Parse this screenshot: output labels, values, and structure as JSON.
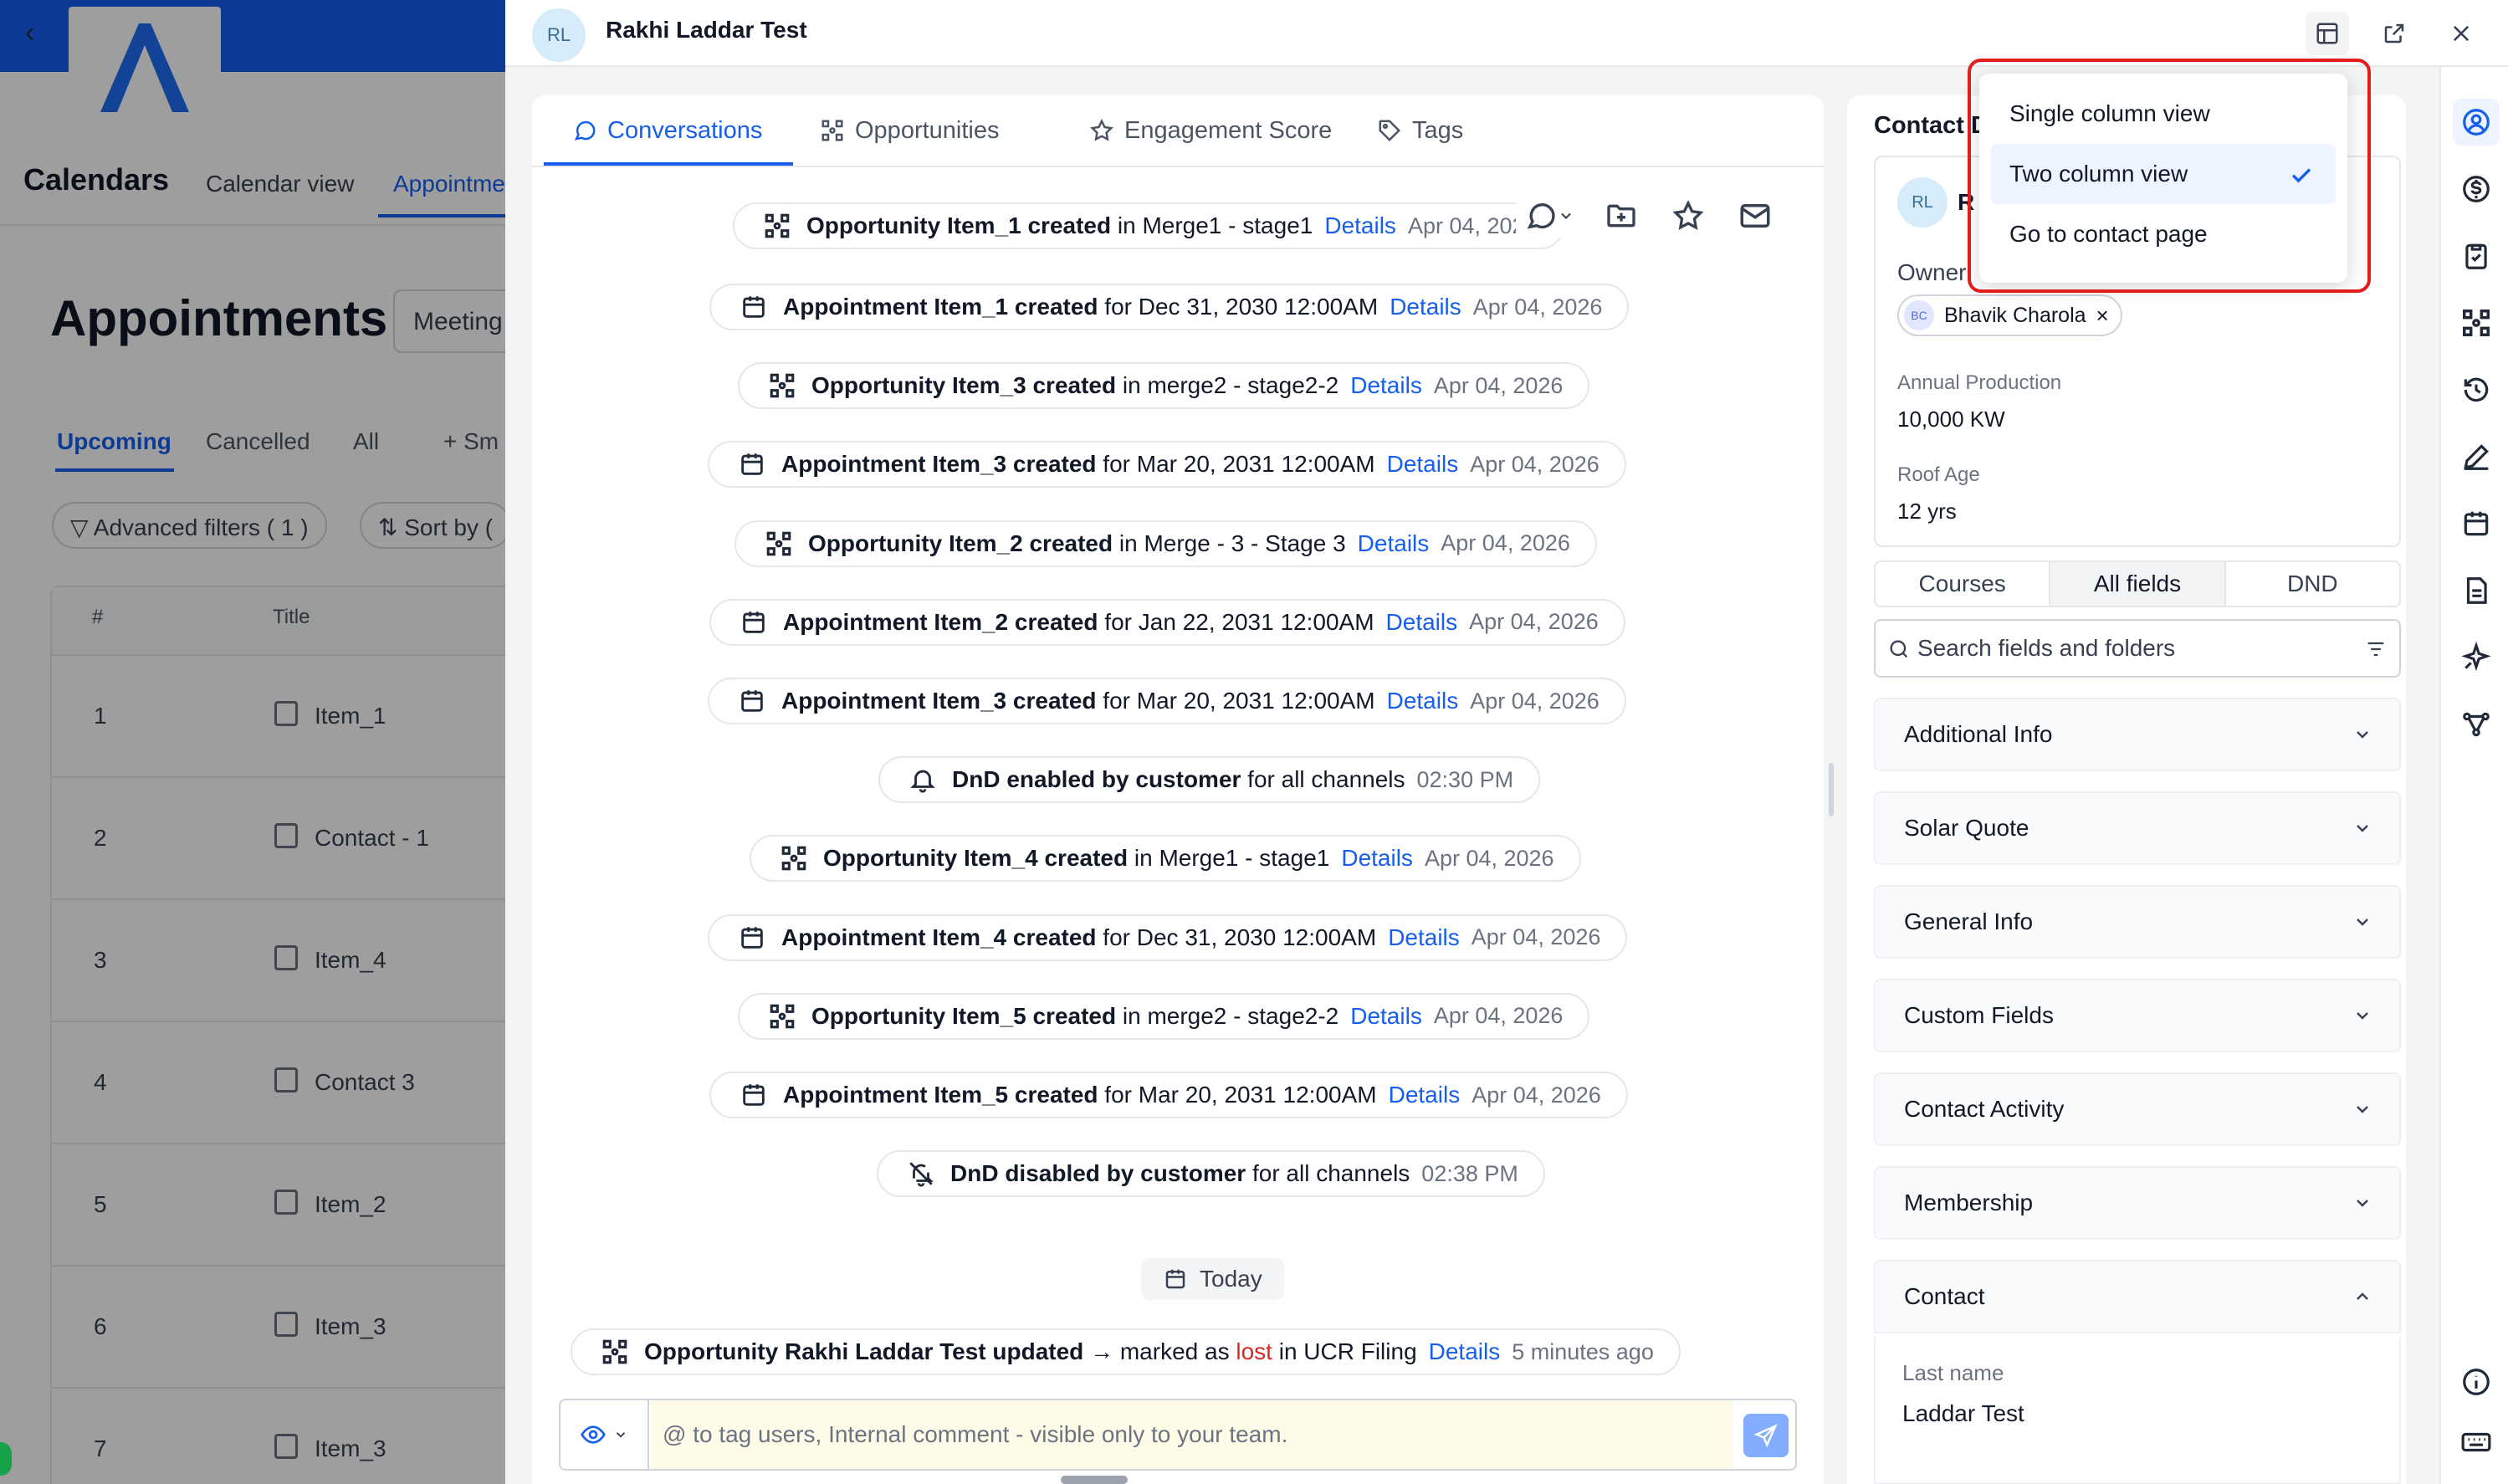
{
  "background": {
    "calendars_title": "Calendars",
    "calendar_tabs": [
      "Calendar view",
      "Appointme"
    ],
    "appointments_title": "Appointments",
    "meeting_filter": "Meeting",
    "sub_tabs": [
      "Upcoming",
      "Cancelled",
      "All",
      "+ Sm"
    ],
    "advanced_filters": "Advanced filters ( 1 )",
    "sort_by": "Sort by (",
    "columns": [
      "#",
      "Title"
    ],
    "rows": [
      {
        "num": "1",
        "title": "Item_1"
      },
      {
        "num": "2",
        "title": "Contact - 1"
      },
      {
        "num": "3",
        "title": "Item_4"
      },
      {
        "num": "4",
        "title": "Contact 3"
      },
      {
        "num": "5",
        "title": "Item_2"
      },
      {
        "num": "6",
        "title": "Item_3"
      },
      {
        "num": "7",
        "title": "Item_3"
      }
    ]
  },
  "drawer": {
    "avatar_initials": "RL",
    "contact_name": "Rakhi Laddar Test"
  },
  "tabs": [
    {
      "label": "Conversations",
      "icon": "chat-icon"
    },
    {
      "label": "Opportunities",
      "icon": "opportunity-icon"
    },
    {
      "label": "Engagement Score",
      "icon": "star-icon"
    },
    {
      "label": "Tags",
      "icon": "tag-icon"
    }
  ],
  "timeline": [
    {
      "icon": "opportunity",
      "bold": "Opportunity Item_1 created",
      "rest": " in Merge1 - stage1",
      "link": "Details",
      "date": "Apr 04, 2026"
    },
    {
      "icon": "calendar",
      "bold": "Appointment Item_1 created",
      "rest": " for Dec 31, 2030 12:00AM",
      "link": "Details",
      "date": "Apr 04, 2026"
    },
    {
      "icon": "opportunity",
      "bold": "Opportunity Item_3 created",
      "rest": " in merge2 - stage2-2",
      "link": "Details",
      "date": "Apr 04, 2026"
    },
    {
      "icon": "calendar",
      "bold": "Appointment Item_3 created",
      "rest": " for Mar 20, 2031 12:00AM",
      "link": "Details",
      "date": "Apr 04, 2026"
    },
    {
      "icon": "opportunity",
      "bold": "Opportunity Item_2 created",
      "rest": " in Merge - 3 - Stage 3",
      "link": "Details",
      "date": "Apr 04, 2026"
    },
    {
      "icon": "calendar",
      "bold": "Appointment Item_2 created",
      "rest": " for Jan 22, 2031 12:00AM",
      "link": "Details",
      "date": "Apr 04, 2026"
    },
    {
      "icon": "calendar",
      "bold": "Appointment Item_3 created",
      "rest": " for Mar 20, 2031 12:00AM",
      "link": "Details",
      "date": "Apr 04, 2026"
    },
    {
      "icon": "bell",
      "bold": "DnD enabled by customer",
      "rest": " for all channels",
      "link": "",
      "date": "02:30 PM"
    },
    {
      "icon": "opportunity",
      "bold": "Opportunity Item_4 created",
      "rest": " in Merge1 - stage1",
      "link": "Details",
      "date": "Apr 04, 2026"
    },
    {
      "icon": "calendar",
      "bold": "Appointment Item_4 created",
      "rest": " for Dec 31, 2030 12:00AM",
      "link": "Details",
      "date": "Apr 04, 2026"
    },
    {
      "icon": "opportunity",
      "bold": "Opportunity Item_5 created",
      "rest": " in merge2 - stage2-2",
      "link": "Details",
      "date": "Apr 04, 2026"
    },
    {
      "icon": "calendar",
      "bold": "Appointment Item_5 created",
      "rest": " for Mar 20, 2031 12:00AM",
      "link": "Details",
      "date": "Apr 04, 2026"
    },
    {
      "icon": "bell-off",
      "bold": "DnD disabled by customer",
      "rest": " for all channels",
      "link": "",
      "date": "02:38 PM"
    }
  ],
  "today_label": "Today",
  "last_event": {
    "bold": "Opportunity Rakhi Laddar Test updated",
    "arrow": " → marked as ",
    "status": "lost",
    "rest": " in UCR Filing",
    "link": "Details",
    "date": "5 minutes ago"
  },
  "composer": {
    "placeholder": "@ to tag users, Internal comment - visible only to your team."
  },
  "contact_panel": {
    "title": "Contact D",
    "avatar_initials": "RL",
    "initial_letter": "R",
    "owner_label": "Owner",
    "owner_initials": "BC",
    "owner_name": "Bhavik Charola",
    "fields": [
      {
        "label": "Annual Production",
        "value": "10,000 KW"
      },
      {
        "label": "Roof Age",
        "value": "12 yrs"
      }
    ],
    "segments": [
      "Courses",
      "All fields",
      "DND"
    ],
    "search_placeholder": "Search fields and folders",
    "sections": [
      "Additional Info",
      "Solar Quote",
      "General Info",
      "Custom Fields",
      "Contact Activity",
      "Membership",
      "Contact"
    ],
    "last_name_label": "Last name",
    "last_name_value": "Laddar Test"
  },
  "menu": {
    "items": [
      "Single column view",
      "Two column view",
      "Go to contact page"
    ],
    "selected": "Two column view"
  },
  "colors": {
    "accent": "#155eef",
    "highlight": "#e11d1d",
    "lost": "#dc2626"
  }
}
